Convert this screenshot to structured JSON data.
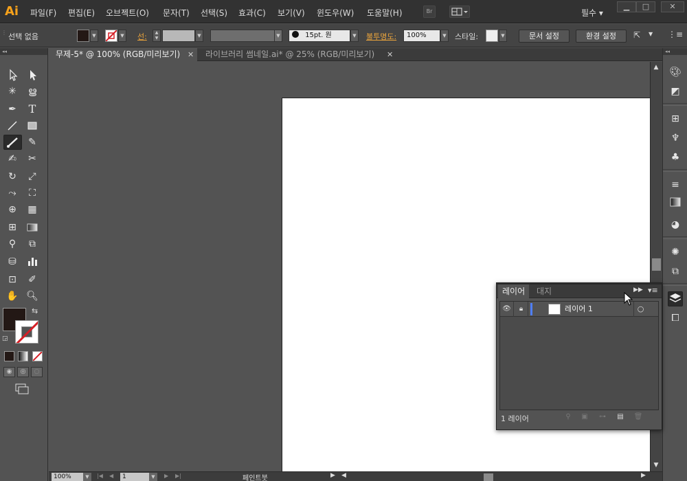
{
  "app": {
    "logo": "Ai"
  },
  "menu": {
    "items": [
      "파일(F)",
      "편집(E)",
      "오브젝트(O)",
      "문자(T)",
      "선택(S)",
      "효과(C)",
      "보기(V)",
      "윈도우(W)",
      "도움말(H)"
    ],
    "bridge_label": "Br",
    "workspace": "필수 ▾",
    "window_buttons": [
      "▁",
      "□",
      "✕"
    ]
  },
  "control": {
    "selection_status": "선택 없음",
    "fill_color": "#231815",
    "stroke_label": "선:",
    "brush_size": "15pt. 원",
    "opacity_label": "불투명도:",
    "opacity_value": "100%",
    "style_label": "스타일:",
    "doc_setup": "문서 설정",
    "preferences": "환경 설정"
  },
  "tabs": [
    {
      "label": "무제-5* @ 100% (RGB/미리보기)",
      "active": true
    },
    {
      "label": "라이브러리 썸네일.ai* @ 25% (RGB/미리보기)",
      "active": false
    }
  ],
  "tools": {
    "fill_color": "#231815",
    "stroke_color": "#ffffff",
    "stroke_none_color": "#d61f26"
  },
  "layers_panel": {
    "tabs": [
      "레이어",
      "대지"
    ],
    "layers": [
      {
        "name": "레이어 1",
        "color": "#4f7fff"
      }
    ],
    "count_label": "1 레이어"
  },
  "status": {
    "zoom": "100%",
    "artboard": "1",
    "tool_name": "페인트붓"
  },
  "icons": {
    "eye": "eye-icon",
    "lock": "lock-icon",
    "close": "close-icon",
    "collapse": "collapse-icon",
    "menu": "panel-menu-icon"
  }
}
